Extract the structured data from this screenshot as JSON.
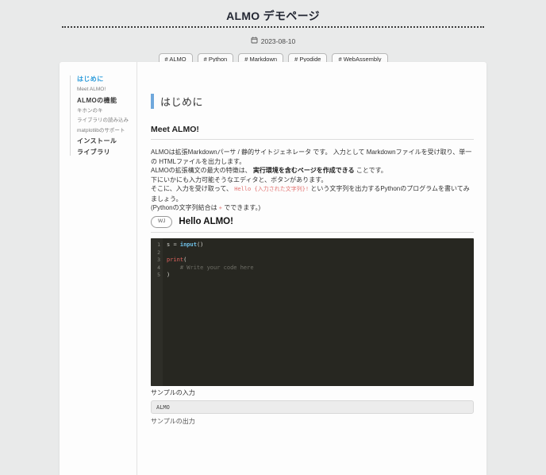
{
  "header": {
    "title": "ALMO デモページ",
    "date_icon": "calendar-icon",
    "date": "2023-08-10",
    "tags": [
      "# ALMO",
      "# Python",
      "# Markdown",
      "# Pyodide",
      "# WebAssembly"
    ]
  },
  "sidebar": {
    "items": [
      {
        "label": "はじめに",
        "level": 1,
        "active": true
      },
      {
        "label": "Meet ALMO!",
        "level": 2,
        "active": false
      },
      {
        "label": "ALMOの機能",
        "level": 1,
        "active": false
      },
      {
        "label": "キホンのキ",
        "level": 2,
        "active": false
      },
      {
        "label": "ライブラリの読み込み",
        "level": 2,
        "active": false
      },
      {
        "label": "matplotlibのサポート",
        "level": 2,
        "active": false
      },
      {
        "label": "インストール",
        "level": 1,
        "active": false
      },
      {
        "label": "ライブラリ",
        "level": 1,
        "active": false
      }
    ]
  },
  "content": {
    "section_title": "はじめに",
    "subsection_title": "Meet ALMO!",
    "paragraph": {
      "line1": "ALMOは拡張Markdownパーサ / 静的サイトジェネレータ です。 入力として Markdownファイルを受け取り、単一の HTMLファイルを出力します。",
      "line2_pre": "ALMOの拡張構文の最大の特徴は、 ",
      "line2_bold": "実行環境を含むページを作成できる",
      "line2_post": " ことです。",
      "line3": "下にいかにも入力可能そうなエディタと、ボタンがあります。",
      "line4_pre": "そこに、入力を受け取って、 ",
      "line4_code": "Hello {入力された文字列}!",
      "line4_post": " という文字列を出力するPythonのプログラムを書いてみましょう。",
      "line5_pre": "(Pythonの文字列結合は ",
      "line5_code": "+",
      "line5_post": " でできます。)"
    },
    "problem": {
      "status_badge": "WJ",
      "title": "Hello ALMO!"
    },
    "editor": {
      "lines": [
        {
          "number": "1",
          "segments": [
            {
              "text": "s ",
              "type": "plain"
            },
            {
              "text": "= ",
              "type": "operator"
            },
            {
              "text": "input",
              "type": "builtin"
            },
            {
              "text": "()",
              "type": "plain"
            }
          ]
        },
        {
          "number": "2",
          "segments": []
        },
        {
          "number": "3",
          "segments": [
            {
              "text": "print",
              "type": "keyword"
            },
            {
              "text": "(",
              "type": "plain"
            }
          ]
        },
        {
          "number": "4",
          "segments": [
            {
              "text": "    # Write your code here",
              "type": "comment"
            }
          ]
        },
        {
          "number": "5",
          "segments": [
            {
              "text": ")",
              "type": "plain"
            }
          ]
        }
      ]
    },
    "sample_input_label": "サンプルの入力",
    "sample_input_value": "ALMO",
    "sample_output_label": "サンプルの出力"
  },
  "colors": {
    "accent_blue": "#2d9cdb",
    "heading_bar_blue": "#6fa8dc",
    "inline_code_red": "#e2716f",
    "editor_background": "#272721",
    "editor_gutter": "#2e2e28",
    "code_keyword": "#e0635e",
    "code_builtin": "#6fc1e8",
    "code_comment": "#6e6e66",
    "page_background": "#e9eaea",
    "card_background": "#fdfdfd"
  }
}
